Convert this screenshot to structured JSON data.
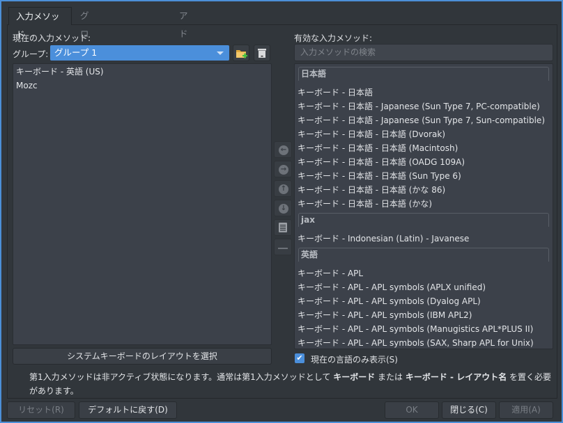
{
  "tabs": [
    {
      "label": "入力メソッド",
      "active": true
    },
    {
      "label": "グローバルオプション"
    },
    {
      "label": "アドオン"
    }
  ],
  "left": {
    "title": "現在の入力メソッド:",
    "group_label": "グループ:",
    "group_value": "グループ 1",
    "add_group_icon": "folder-add-icon",
    "delete_group_icon": "trash-icon",
    "items": [
      "キーボード - 英語 (US)",
      "Mozc"
    ],
    "select_layout_button": "システムキーボードのレイアウトを選択"
  },
  "middle_buttons": [
    "arrow-left-icon",
    "arrow-right-icon",
    "arrow-up-icon",
    "arrow-down-icon",
    "configure-icon",
    "remove-icon"
  ],
  "right": {
    "title": "有効な入力メソッド:",
    "search_placeholder": "入力メソッドの検索",
    "groups": [
      {
        "name": "日本語",
        "items": [
          "キーボード - 日本語",
          "キーボード - 日本語 - Japanese (Sun Type 7, PC-compatible)",
          "キーボード - 日本語 - Japanese (Sun Type 7, Sun-compatible)",
          "キーボード - 日本語 - 日本語 (Dvorak)",
          "キーボード - 日本語 - 日本語 (Macintosh)",
          "キーボード - 日本語 - 日本語 (OADG 109A)",
          "キーボード - 日本語 - 日本語 (Sun Type 6)",
          "キーボード - 日本語 - 日本語 (かな 86)",
          "キーボード - 日本語 - 日本語 (かな)"
        ]
      },
      {
        "name": "jax",
        "items": [
          "キーボード - Indonesian (Latin) - Javanese"
        ]
      },
      {
        "name": "英語",
        "items": [
          "キーボード - APL",
          "キーボード - APL - APL symbols (APLX unified)",
          "キーボード - APL - APL symbols (Dyalog APL)",
          "キーボード - APL - APL symbols (IBM APL2)",
          "キーボード - APL - APL symbols (Manugistics APL*PLUS II)",
          "キーボード - APL - APL symbols (SAX, Sharp APL for Unix)"
        ]
      }
    ],
    "only_current_language": {
      "label": "現在の言語のみ表示(S)",
      "checked": true
    }
  },
  "info": {
    "part1": "第1入力メソッドは非アクティブ状態になります。通常は第1入力メソッドとして ",
    "bold1": "キーボード",
    "part2": " または ",
    "bold2": "キーボード - レイアウト名",
    "part3": " を置く必要があります。"
  },
  "buttons": {
    "reset": "リセット(R)",
    "defaults": "デフォルトに戻す(D)",
    "ok": "OK",
    "close": "閉じる(C)",
    "apply": "適用(A)"
  },
  "colors": {
    "accent": "#4b8fdb",
    "background": "#31363b"
  }
}
